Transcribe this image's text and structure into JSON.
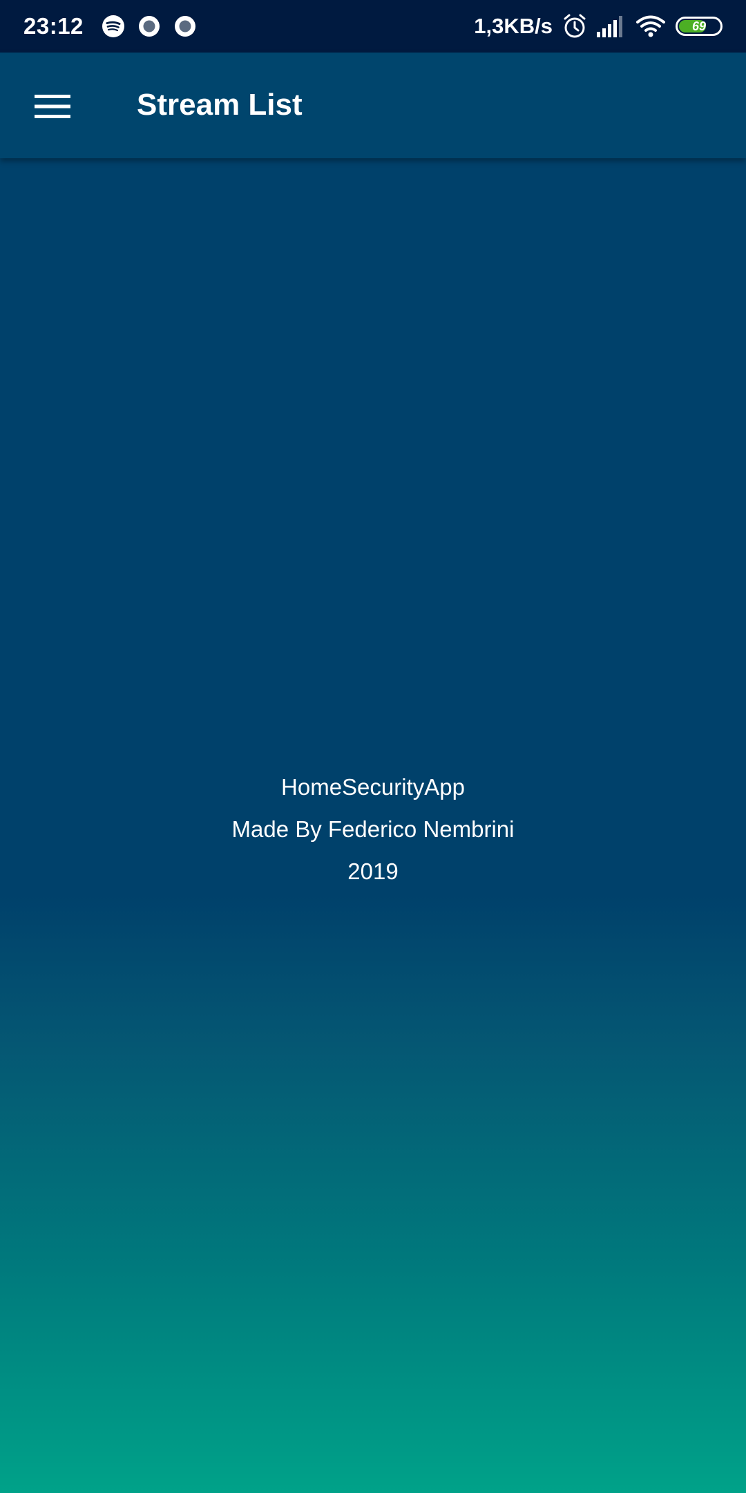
{
  "status_bar": {
    "time": "23:12",
    "notification_icons": [
      "spotify-icon",
      "record-icon",
      "record-icon"
    ],
    "net_speed": "1,3KB/s",
    "system_icons": [
      "alarm-icon",
      "signal-icon",
      "wifi-icon"
    ],
    "battery_level": "69",
    "battery_fraction": 0.69,
    "battery_color": "#4caf24"
  },
  "app_bar": {
    "title": "Stream List",
    "menu_icon": "hamburger-menu-icon",
    "background": "#00456d"
  },
  "credits": {
    "app_name": "HomeSecurityApp",
    "author": "Made By Federico Nembrini",
    "year": "2019"
  },
  "colors": {
    "status_bar_bg": "#001a40",
    "gradient_top": "#00416b",
    "gradient_bottom": "#00a289",
    "text": "#ffffff"
  }
}
